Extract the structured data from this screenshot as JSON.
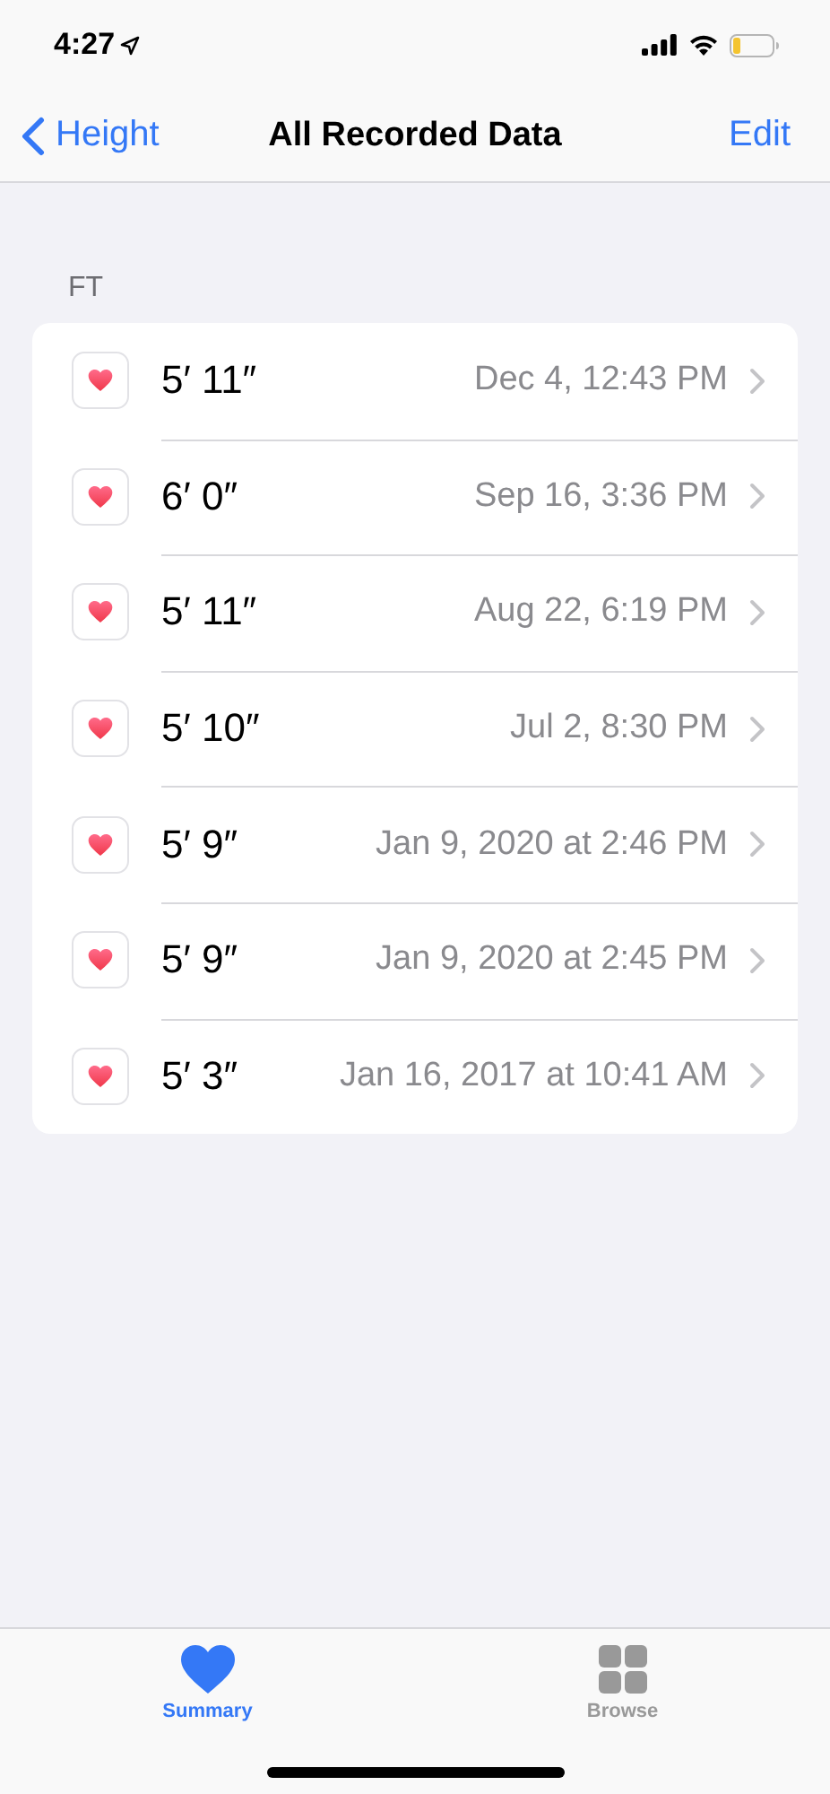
{
  "status_bar": {
    "time": "4:27"
  },
  "nav": {
    "back": "Height",
    "title": "All Recorded Data",
    "action": "Edit"
  },
  "section": {
    "header": "FT",
    "rows": [
      {
        "value": "5′ 11″",
        "date": "Dec 4, 12:43 PM"
      },
      {
        "value": "6′ 0″",
        "date": "Sep 16, 3:36 PM"
      },
      {
        "value": "5′ 11″",
        "date": "Aug 22, 6:19 PM"
      },
      {
        "value": "5′ 10″",
        "date": "Jul 2, 8:30 PM"
      },
      {
        "value": "5′ 9″",
        "date": "Jan 9, 2020 at 2:46 PM"
      },
      {
        "value": "5′ 9″",
        "date": "Jan 9, 2020 at 2:45 PM"
      },
      {
        "value": "5′ 3″",
        "date": "Jan 16, 2017 at 10:41 AM"
      }
    ]
  },
  "tab_bar": [
    {
      "label": "Summary",
      "kind": "heart",
      "selected": true
    },
    {
      "label": "Browse",
      "kind": "grid",
      "selected": false
    }
  ]
}
